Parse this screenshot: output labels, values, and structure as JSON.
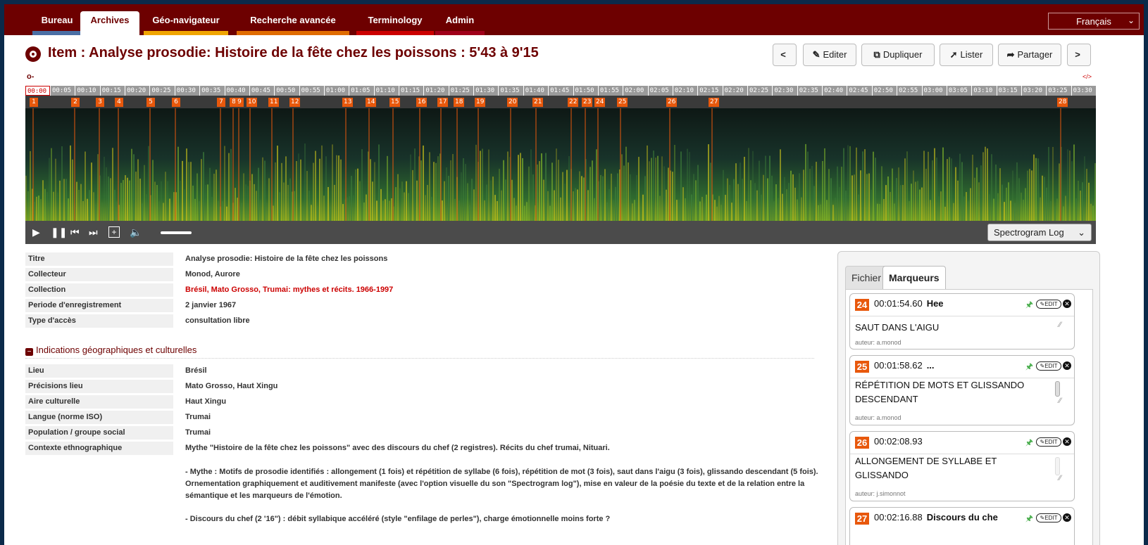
{
  "nav": {
    "tabs": [
      {
        "label": "Bureau",
        "color": "#4a6fa5"
      },
      {
        "label": "Archives",
        "color": "#e8e8e8"
      },
      {
        "label": "Géo-navigateur",
        "color": "#f0a500"
      },
      {
        "label": "Recherche avancée",
        "color": "#e06c00"
      },
      {
        "label": "Terminology",
        "color": "#cc0000"
      },
      {
        "label": "Admin",
        "color": "#a0001a"
      }
    ],
    "active": "Archives",
    "language": "Français"
  },
  "title": "Item : Analyse prosodie: Histoire de la fête chez les poissons : 5'43 à 9'15",
  "toolbar": {
    "prev_label": "<",
    "edit_label": "Editer",
    "duplicate_label": "Dupliquer",
    "list_label": "Lister",
    "share_label": "Partager",
    "next_label": ">"
  },
  "player": {
    "code_label": "</>",
    "current_time": "00:00",
    "ticks": [
      "00:05",
      "00:10",
      "00:15",
      "00:20",
      "00:25",
      "00:30",
      "00:35",
      "00:40",
      "00:45",
      "00:50",
      "00:55",
      "01:00",
      "01:05",
      "01:10",
      "01:15",
      "01:20",
      "01:25",
      "01:30",
      "01:35",
      "01:40",
      "01:45",
      "01:50",
      "01:55",
      "02:00",
      "02:05",
      "02:10",
      "02:15",
      "02:20",
      "02:25",
      "02:30",
      "02:35",
      "02:40",
      "02:45",
      "02:50",
      "02:55",
      "03:00",
      "03:05",
      "03:10",
      "03:15",
      "03:20",
      "03:25",
      "03:30"
    ],
    "markers": [
      "1",
      "2",
      "3",
      "4",
      "5",
      "6",
      "7",
      "8",
      "9",
      "10",
      "11",
      "12",
      "13",
      "14",
      "15",
      "16",
      "17",
      "18",
      "19",
      "20",
      "21",
      "22",
      "23",
      "24",
      "25",
      "26",
      "27",
      "28"
    ],
    "view_mode": "Spectrogram Log"
  },
  "metadata": [
    {
      "label": "Titre",
      "value": "Analyse prosodie: Histoire de la fête chez les poissons"
    },
    {
      "label": "Collecteur",
      "value": "Monod, Aurore"
    },
    {
      "label": "Collection",
      "value": "Brésil, Mato Grosso, Trumai: mythes et récits. 1966-1997"
    },
    {
      "label": "Periode d'enregistrement",
      "value": "2 janvier 1967"
    },
    {
      "label": "Type d'accès",
      "value": "consultation libre"
    }
  ],
  "geo_section": {
    "title": "Indications géographiques et culturelles",
    "rows": [
      {
        "label": "Lieu",
        "value": "Brésil"
      },
      {
        "label": "Précisions lieu",
        "value": "Mato Grosso, Haut Xingu"
      },
      {
        "label": "Aire culturelle",
        "value": "Haut Xingu"
      },
      {
        "label": "Langue (norme ISO)",
        "value": "Trumai"
      },
      {
        "label": "Population / groupe social",
        "value": "Trumai"
      },
      {
        "label": "Contexte ethnographique",
        "value": "Mythe \"Histoire de la fête chez les poissons\" avec des discours du chef (2 registres). Récits du chef trumai, Nituari."
      }
    ],
    "paragraphs": [
      "- Mythe : Motifs de prosodie identifiés : allongement (1 fois) et répétition de syllabe (6 fois), répétition de mot (3 fois), saut dans l'aigu (3 fois), glissando descendant (5 fois). Ornementation graphiquement et auditivement manifeste (avec l'option visuelle du son \"Spectrogram log\"), mise en valeur de la poésie du texte et de la relation entre la sémantique et les marqueurs de l'émotion.",
      "- Discours du chef (2 '16\") : débit syllabique accéléré (style \"enfilage de perles\"), charge émotionnelle moins forte ?"
    ]
  },
  "panel": {
    "tab_file": "Fichier",
    "tab_markers": "Marqueurs",
    "edit_label": "EDIT",
    "markers": [
      {
        "num": "24",
        "time": "00:01:54.60",
        "name": "Hee",
        "desc": "SAUT DANS L'AIGU",
        "author": "auteur: a.monod"
      },
      {
        "num": "25",
        "time": "00:01:58.62",
        "name": "...",
        "desc": "RÉPÉTITION DE MOTS ET GLISSANDO DESCENDANT",
        "author": "auteur: a.monod"
      },
      {
        "num": "26",
        "time": "00:02:08.93",
        "name": "",
        "desc": "ALLONGEMENT DE SYLLABE ET GLISSANDO",
        "author": "auteur: j.simonnot"
      },
      {
        "num": "27",
        "time": "00:02:16.88",
        "name": "Discours du che",
        "desc": "",
        "author": ""
      }
    ]
  }
}
